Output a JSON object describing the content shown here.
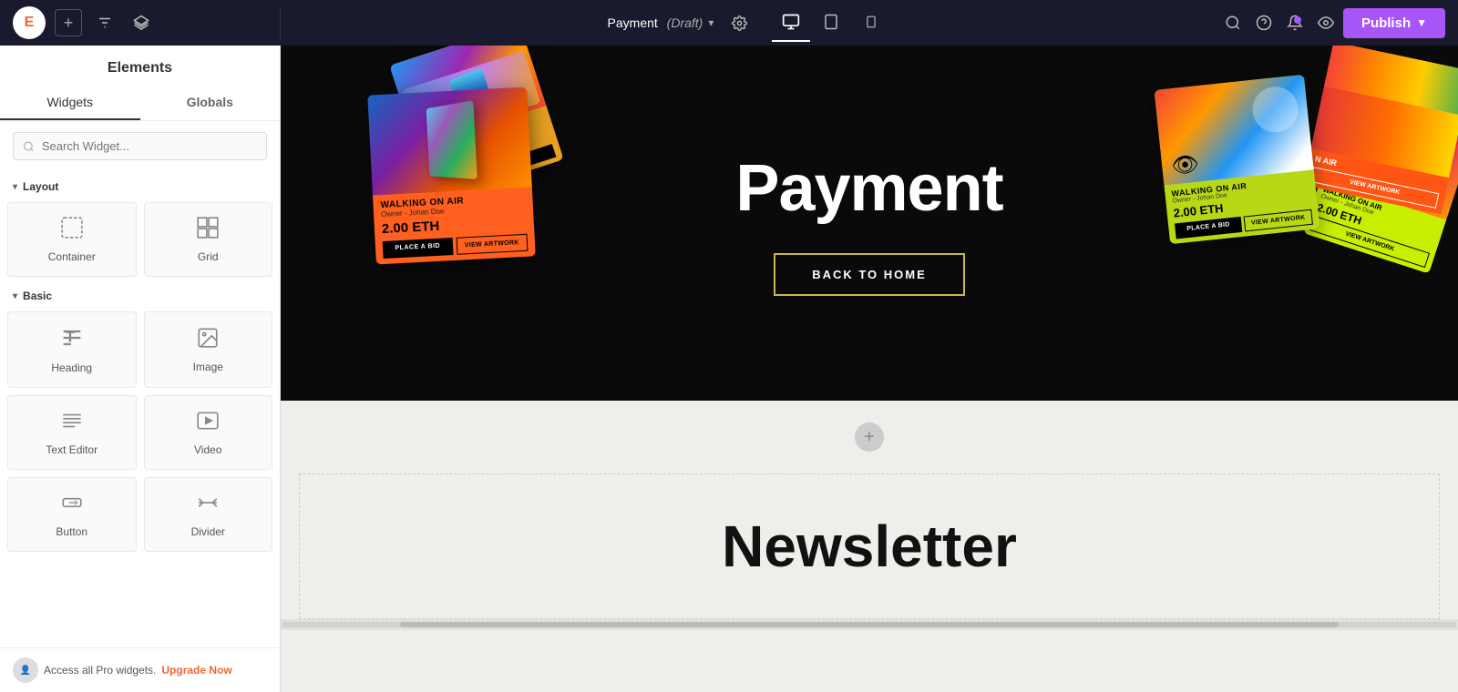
{
  "topbar": {
    "logo_text": "E",
    "page_title": "Payment",
    "page_status": "(Draft)",
    "settings_icon": "⚙",
    "add_icon": "+",
    "filters_icon": "⚙",
    "layers_icon": "⧉",
    "desktop_icon": "🖥",
    "tablet_icon": "⬜",
    "mobile_icon": "📱",
    "search_icon": "🔍",
    "help_icon": "?",
    "bell_icon": "🔔",
    "eye_icon": "👁",
    "publish_label": "Publish",
    "publish_arrow": "▼"
  },
  "sidebar": {
    "title": "Elements",
    "tabs": [
      {
        "id": "widgets",
        "label": "Widgets",
        "active": true
      },
      {
        "id": "globals",
        "label": "Globals",
        "active": false
      }
    ],
    "search_placeholder": "Search Widget...",
    "sections": [
      {
        "id": "layout",
        "label": "Layout",
        "widgets": [
          {
            "id": "container",
            "label": "Container",
            "icon": "⬚"
          },
          {
            "id": "grid",
            "label": "Grid",
            "icon": "⊞"
          }
        ]
      },
      {
        "id": "basic",
        "label": "Basic",
        "widgets": [
          {
            "id": "heading",
            "label": "Heading",
            "icon": "T"
          },
          {
            "id": "image",
            "label": "Image",
            "icon": "🖼"
          },
          {
            "id": "text-editor",
            "label": "Text Editor",
            "icon": "≡"
          },
          {
            "id": "video",
            "label": "Video",
            "icon": "▶"
          },
          {
            "id": "button",
            "label": "Button",
            "icon": "⬜"
          },
          {
            "id": "divider",
            "label": "Divider",
            "icon": "—"
          }
        ]
      }
    ],
    "footer_text": "Access all Pro widgets.",
    "upgrade_label": "Upgrade Now"
  },
  "canvas": {
    "hero": {
      "title": "Payment",
      "button_label": "BACK TO HOME"
    },
    "cards": [
      {
        "title": "WALKING ON AIR",
        "owner": "Johan Doe",
        "price": "2.00 ETH"
      },
      {
        "title": "WALKING ON AIR",
        "owner": "Johan Doe",
        "price": "2.00 ETH"
      }
    ],
    "card_btn_bid": "PLACE A BID",
    "card_btn_view": "VIEW ARTWORK",
    "newsletter": {
      "title": "Newsletter"
    }
  },
  "colors": {
    "topbar_bg": "#1a1a2e",
    "sidebar_bg": "#ffffff",
    "canvas_bg": "#f0eeeb",
    "hero_bg": "#0a0a0a",
    "publish_bg": "#a855f7",
    "card_orange": "#ff8c42",
    "card_yellow": "#d4ff00",
    "card_cyan": "#00e5ff"
  }
}
